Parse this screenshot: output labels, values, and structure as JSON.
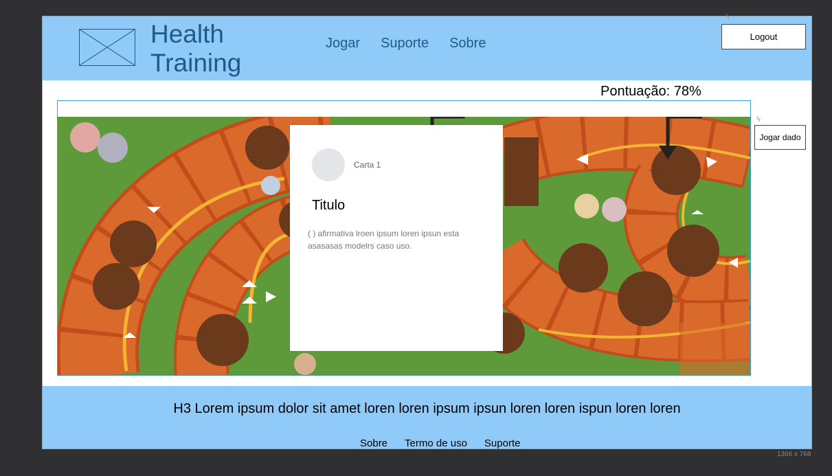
{
  "brand": {
    "line1": "Health",
    "line2": "Training"
  },
  "nav": {
    "items": [
      "Jogar",
      "Suporte",
      "Sobre"
    ]
  },
  "header": {
    "logout_label": "Logout"
  },
  "game": {
    "score_text": "Pontuação: 78%",
    "dice_label": "Jogar dado",
    "card": {
      "label": "Carta 1",
      "title": "Titulo",
      "text": "( ) afirmativa lroen ipsum loren ipsun esta asasasas modelrs caso uso."
    }
  },
  "footer": {
    "heading": "H3 Lorem ipsum dolor sit amet loren loren ipsum ipsun loren loren ispun loren loren",
    "links": [
      "Sobre",
      "Termo de uso",
      "Suporte"
    ]
  },
  "canvas_size_label": "1366 x 768",
  "colors": {
    "header_bg": "#90caf9",
    "brand_text": "#1e5a8a",
    "board_grass": "#5f9a3a",
    "board_tile": "#d96a2b",
    "board_circle": "#6b3a1c",
    "path_yellow": "#f2b632"
  },
  "icons": [
    "image-placeholder-icon",
    "bolt-icon"
  ]
}
